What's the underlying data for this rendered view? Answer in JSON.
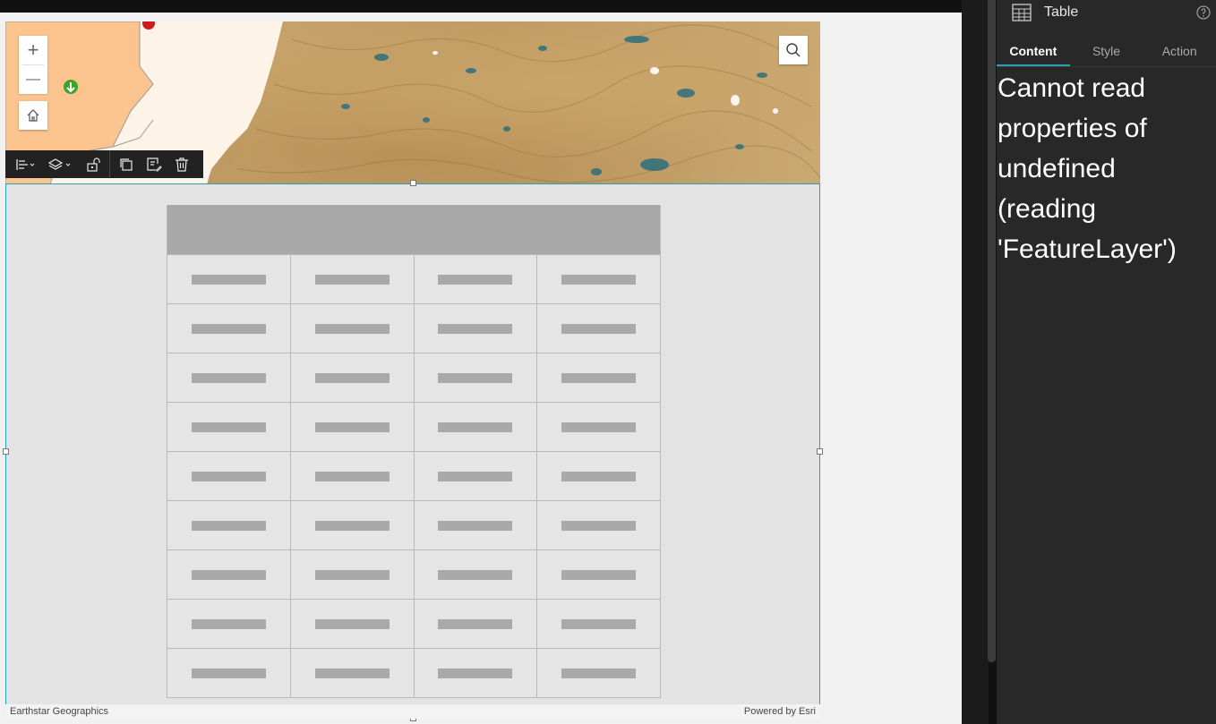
{
  "map": {
    "attribution_left": "Earthstar Geographics",
    "attribution_right": "Powered by Esri",
    "zoom_in_glyph": "+",
    "zoom_out_glyph": "—"
  },
  "table_placeholder": {
    "columns": 4,
    "rows": 9
  },
  "panel": {
    "title": "Table",
    "tabs": [
      {
        "label": "Content",
        "active": true
      },
      {
        "label": "Style",
        "active": false
      },
      {
        "label": "Action",
        "active": false
      }
    ],
    "error_message": "Cannot read properties of undefined (reading 'FeatureLayer')"
  },
  "colors": {
    "accent": "#2aa1b3",
    "panel_bg": "#282828",
    "toolbar_bg": "#222222",
    "placeholder_gray": "#a9a9a9"
  },
  "icons": {
    "toolbar": [
      "align-icon",
      "layers-icon",
      "unlock-icon",
      "duplicate-icon",
      "edit-icon",
      "delete-icon"
    ],
    "map": [
      "zoom-in-icon",
      "zoom-out-icon",
      "home-icon",
      "search-icon"
    ],
    "panel": [
      "table-icon",
      "help-icon"
    ]
  }
}
